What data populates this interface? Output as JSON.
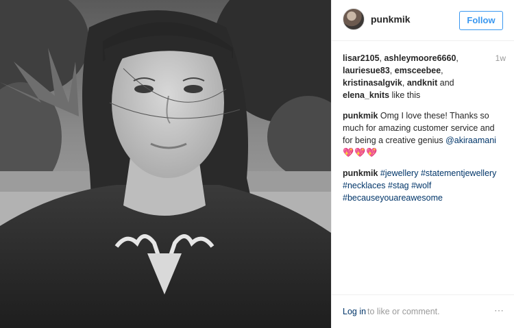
{
  "post": {
    "author": "punkmik",
    "follow_label": "Follow",
    "likes": {
      "users": [
        "lisar2105",
        "ashleymoore6660",
        "lauriesue83",
        "emsceebee",
        "kristinasalgvik",
        "andknit",
        "elena_knits"
      ],
      "sep": ", ",
      "and_word": " and ",
      "suffix": " like this"
    },
    "time_ago": "1w",
    "comments": [
      {
        "user": "punkmik",
        "text": " Omg I love these! Thanks so much for amazing customer service and for being a creative genius ",
        "mention": "@akiraamani",
        "emoji": "💖💖💖"
      },
      {
        "user": "punkmik",
        "hashtags": [
          "#jewellery",
          "#statementjewellery",
          "#necklaces",
          "#stag",
          "#wolf",
          "#becauseyouareawesome"
        ]
      }
    ],
    "footer": {
      "login_link": "Log in",
      "login_text": " to like or comment.",
      "more_icon": "⋯"
    }
  },
  "icons": {
    "avatar": "profile-avatar",
    "more": "more-options-icon"
  },
  "colors": {
    "accent": "#3897f0",
    "link": "#003569",
    "muted": "#999999",
    "border": "#efefef"
  }
}
